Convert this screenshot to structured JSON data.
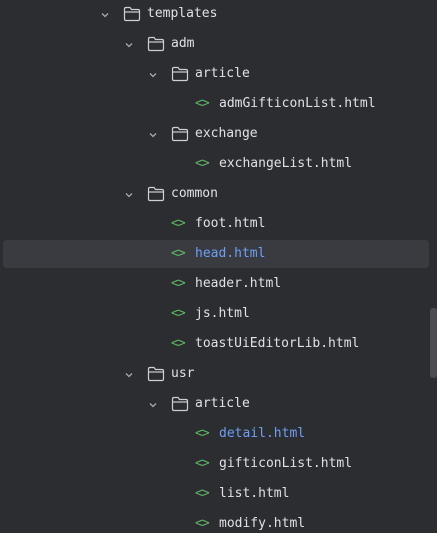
{
  "tree": {
    "items": [
      {
        "type": "folder",
        "label": "templates",
        "expanded": true
      },
      {
        "type": "folder",
        "label": "adm",
        "expanded": true
      },
      {
        "type": "folder",
        "label": "article",
        "expanded": true
      },
      {
        "type": "file",
        "label": "admGifticonList.html",
        "icon": "html-icon"
      },
      {
        "type": "folder",
        "label": "exchange",
        "expanded": true
      },
      {
        "type": "file",
        "label": "exchangeList.html",
        "icon": "html-icon"
      },
      {
        "type": "folder",
        "label": "common",
        "expanded": true
      },
      {
        "type": "file",
        "label": "foot.html",
        "icon": "html-icon"
      },
      {
        "type": "file",
        "label": "head.html",
        "icon": "html-icon",
        "selected": true,
        "modified": true
      },
      {
        "type": "file",
        "label": "header.html",
        "icon": "html-icon"
      },
      {
        "type": "file",
        "label": "js.html",
        "icon": "html-icon"
      },
      {
        "type": "file",
        "label": "toastUiEditorLib.html",
        "icon": "html-icon"
      },
      {
        "type": "folder",
        "label": "usr",
        "expanded": true
      },
      {
        "type": "folder",
        "label": "article",
        "expanded": true
      },
      {
        "type": "file",
        "label": "detail.html",
        "icon": "html-icon",
        "modified": true
      },
      {
        "type": "file",
        "label": "gifticonList.html",
        "icon": "html-icon"
      },
      {
        "type": "file",
        "label": "list.html",
        "icon": "html-icon"
      },
      {
        "type": "file",
        "label": "modify.html",
        "icon": "html-icon"
      }
    ],
    "html_icon_glyph": "<>"
  },
  "colors": {
    "background": "#2b2d30",
    "selection": "#393b40",
    "text": "#dfe1e5",
    "modified_text": "#6f9ff5",
    "html_icon": "#5fb865",
    "chevron": "#a8abb0",
    "folder_outline": "#ced0d6"
  }
}
